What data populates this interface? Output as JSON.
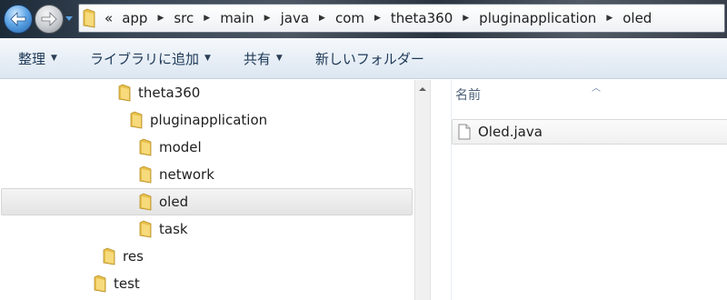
{
  "address_bar": {
    "overflow_glyph": "«",
    "crumbs": [
      "app",
      "src",
      "main",
      "java",
      "com",
      "theta360",
      "pluginapplication",
      "oled"
    ]
  },
  "toolbar": {
    "organize_label": "整理",
    "library_label": "ライブラリに追加",
    "share_label": "共有",
    "new_folder_label": "新しいフォルダー"
  },
  "tree": {
    "items": [
      {
        "label": "theta360"
      },
      {
        "label": "pluginapplication"
      },
      {
        "label": "model"
      },
      {
        "label": "network"
      },
      {
        "label": "oled",
        "selected": true
      },
      {
        "label": "task"
      },
      {
        "label": "res"
      },
      {
        "label": "test"
      }
    ]
  },
  "list": {
    "column_name": "名前",
    "files": [
      {
        "name": "Oled.java"
      }
    ]
  },
  "icons": {
    "back": "back-arrow-icon",
    "forward": "forward-arrow-icon",
    "folder": "folder-icon",
    "file": "file-icon"
  },
  "colors": {
    "folder": "#e8c04a",
    "toolbar_text": "#1e3957",
    "back_button": "#2f7ed0"
  }
}
